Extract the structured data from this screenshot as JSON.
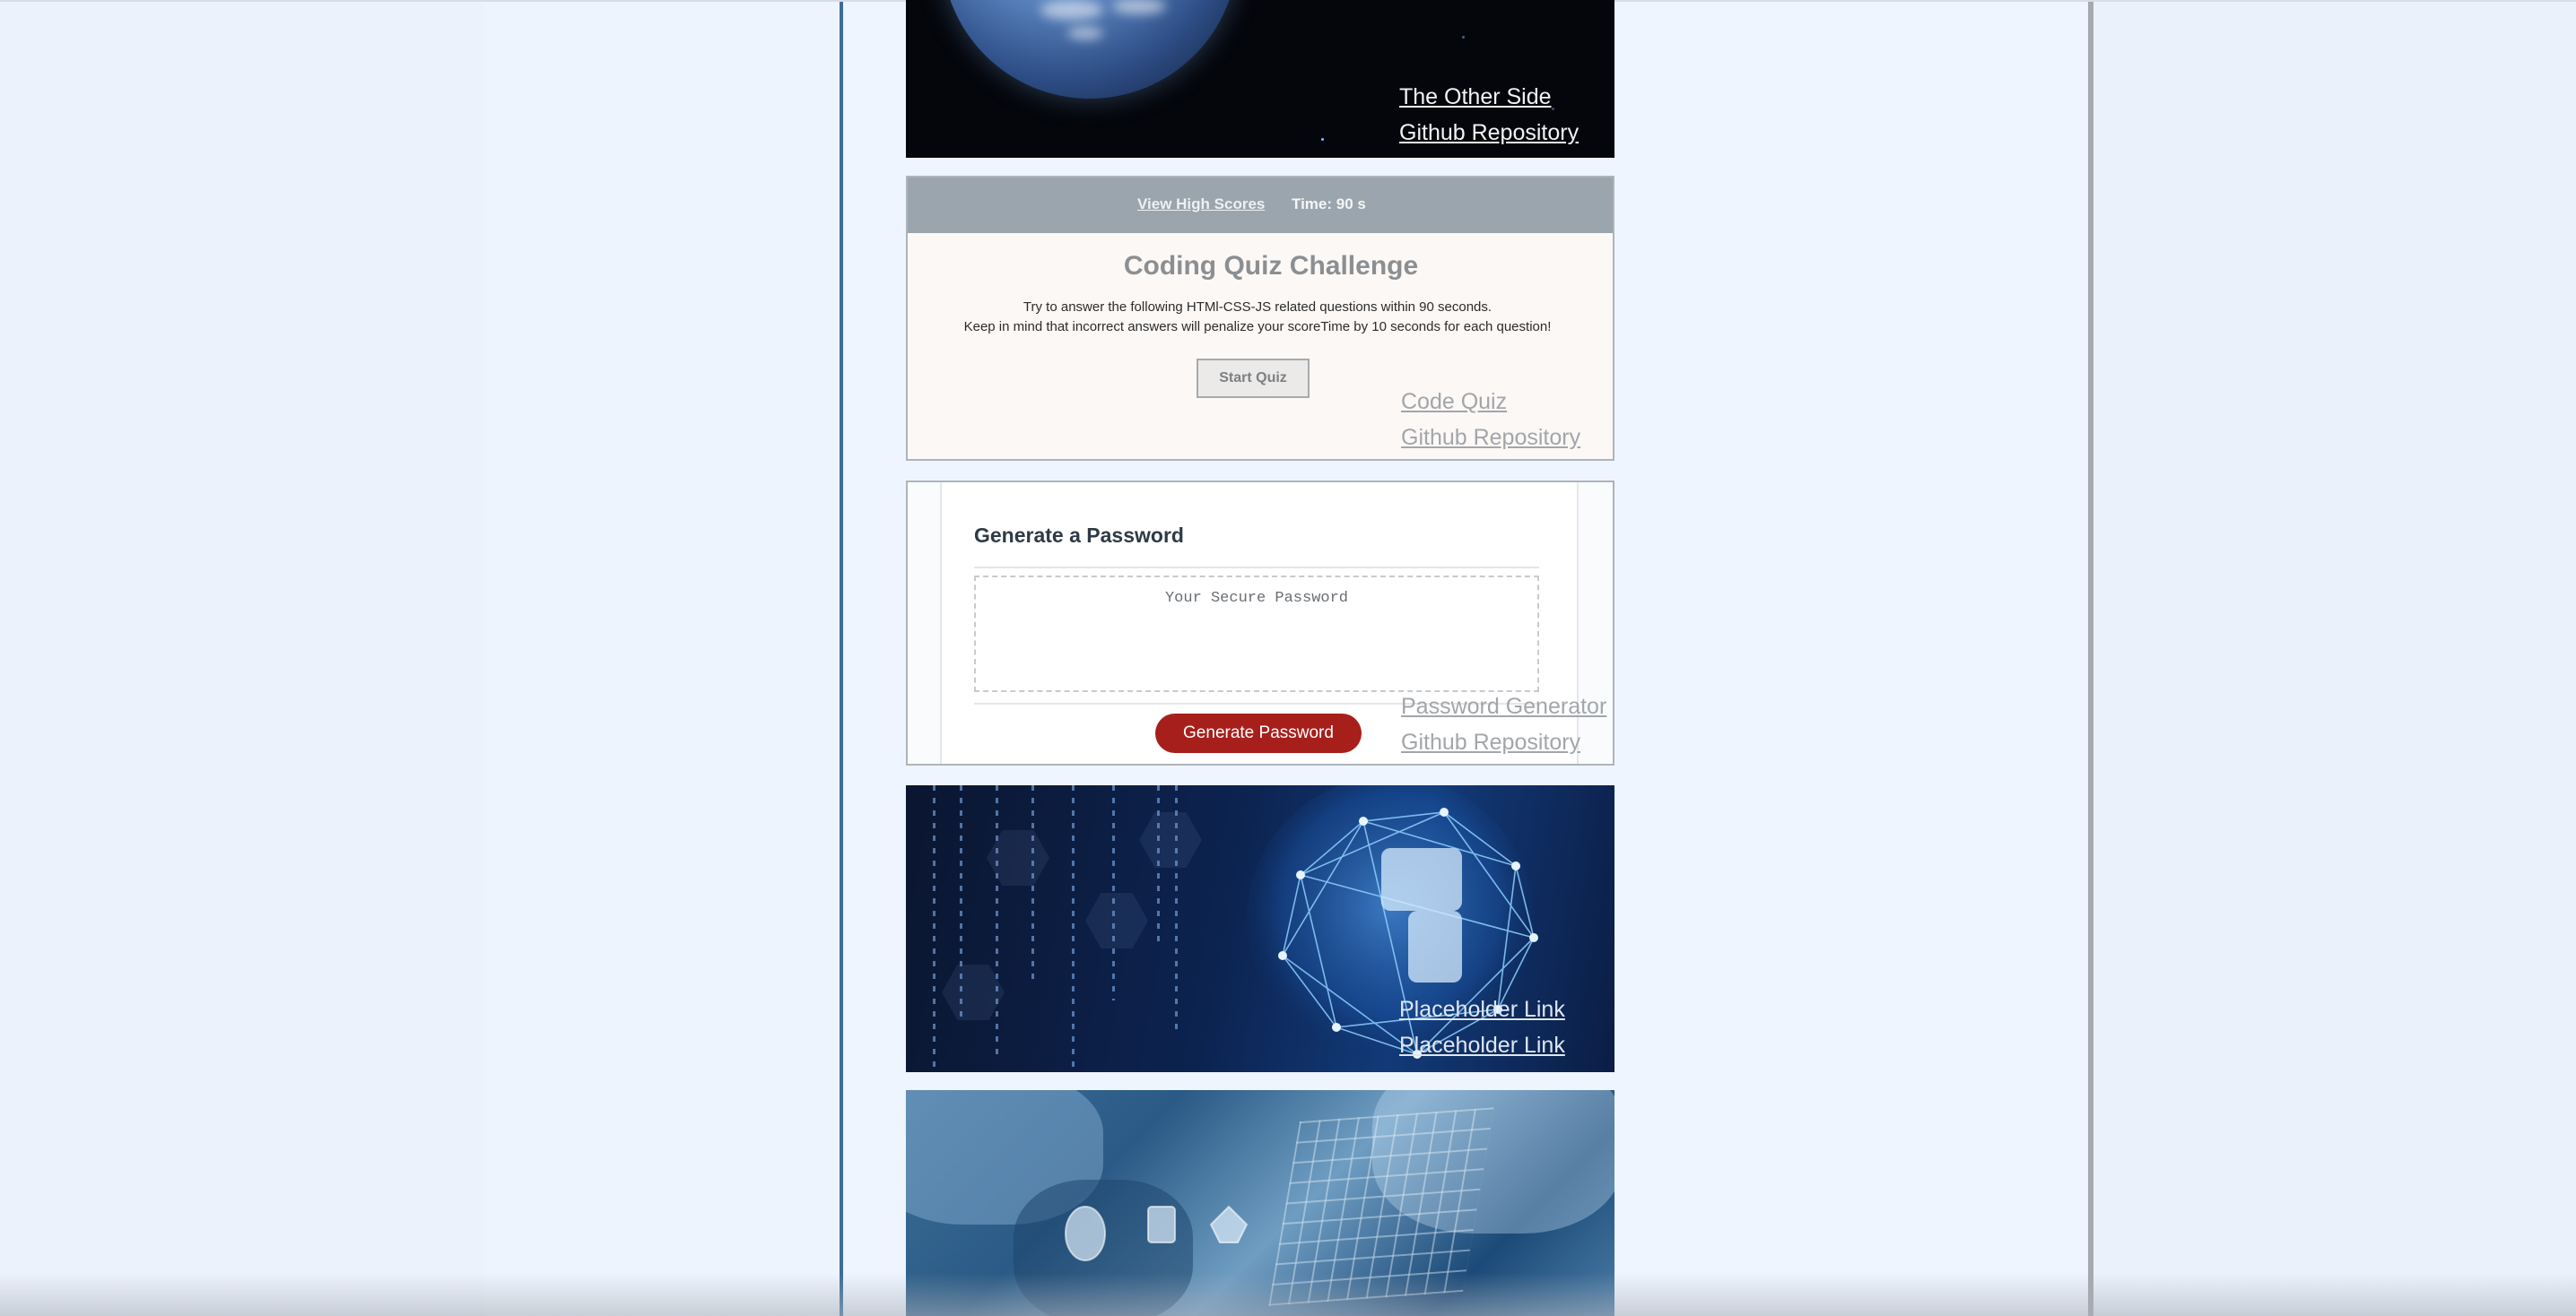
{
  "cards": {
    "earth": {
      "link1": "The Other Side",
      "link2": "Github Repository"
    },
    "quiz": {
      "high_scores": "View High Scores",
      "timer": "Time: 90 s",
      "title": "Coding Quiz Challenge",
      "line1": "Try to answer the following HTMl-CSS-JS related questions within 90 seconds.",
      "line2": "Keep in mind that incorrect answers will penalize your scoreTime by 10 seconds for each question!",
      "start_button": "Start Quiz",
      "link1": "Code Quiz",
      "link2": "Github Repository"
    },
    "password": {
      "title": "Generate a Password",
      "placeholder": "Your Secure Password",
      "button": "Generate Password",
      "link1": "Password Generator",
      "link2": "Github Repository"
    },
    "globe": {
      "link1": "Placeholder Link",
      "link2": "Placeholder Link"
    }
  }
}
